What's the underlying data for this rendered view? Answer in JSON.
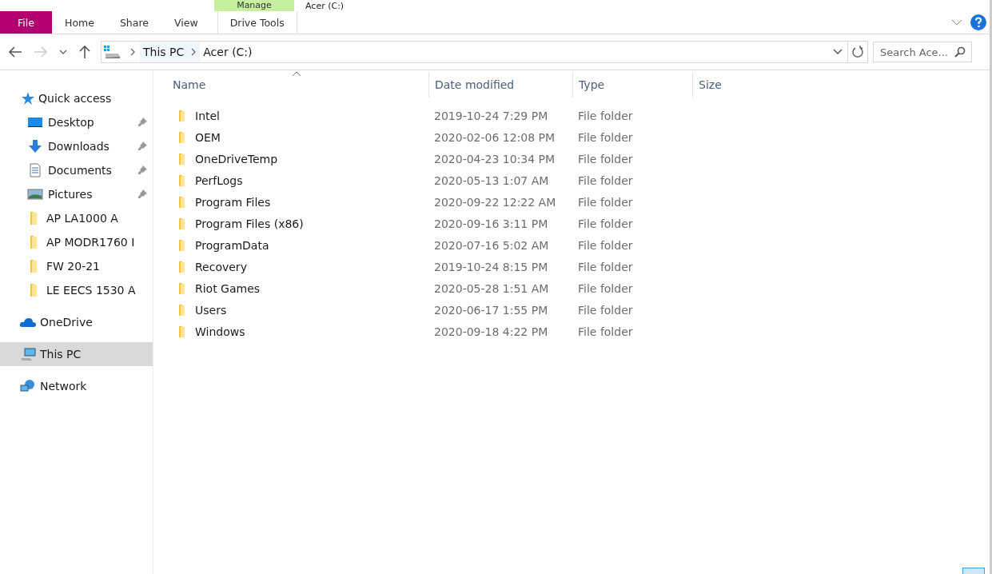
{
  "window": {
    "title": "Acer (C:)"
  },
  "ribbon": {
    "contextual_group": "Manage",
    "tabs": [
      {
        "label": "File",
        "kind": "file"
      },
      {
        "label": "Home",
        "kind": "normal"
      },
      {
        "label": "Share",
        "kind": "normal"
      },
      {
        "label": "View",
        "kind": "normal"
      },
      {
        "label": "Drive Tools",
        "kind": "contextual"
      }
    ]
  },
  "address_bar": {
    "crumbs": [
      "This PC",
      "Acer (C:)"
    ]
  },
  "search": {
    "placeholder": "Search Ace..."
  },
  "sidebar": {
    "items": [
      {
        "label": "Quick access",
        "kind": "quick",
        "pinned": false,
        "selected": false,
        "children": [
          {
            "label": "Desktop",
            "kind": "desktop",
            "pinned": true,
            "selected": false
          },
          {
            "label": "Downloads",
            "kind": "downloads",
            "pinned": true,
            "selected": false
          },
          {
            "label": "Documents",
            "kind": "documents",
            "pinned": true,
            "selected": false
          },
          {
            "label": "Pictures",
            "kind": "pictures",
            "pinned": true,
            "selected": false
          },
          {
            "label": "AP LA1000 A",
            "kind": "folder",
            "pinned": false,
            "selected": false
          },
          {
            "label": "AP MODR1760 I",
            "kind": "folder",
            "pinned": false,
            "selected": false
          },
          {
            "label": "FW 20-21",
            "kind": "folder",
            "pinned": false,
            "selected": false
          },
          {
            "label": "LE EECS 1530 A",
            "kind": "folder",
            "pinned": false,
            "selected": false
          }
        ]
      },
      {
        "label": "OneDrive",
        "kind": "cloud",
        "pinned": false,
        "selected": false
      },
      {
        "label": "This PC",
        "kind": "pc",
        "pinned": false,
        "selected": true
      },
      {
        "label": "Network",
        "kind": "network",
        "pinned": false,
        "selected": false
      }
    ]
  },
  "table": {
    "columns": [
      "Name",
      "Date modified",
      "Type",
      "Size"
    ],
    "rows": [
      {
        "name": "Intel",
        "date": "2019-10-24 7:29 PM",
        "type": "File folder"
      },
      {
        "name": "OEM",
        "date": "2020-02-06 12:08 PM",
        "type": "File folder"
      },
      {
        "name": "OneDriveTemp",
        "date": "2020-04-23 10:34 PM",
        "type": "File folder"
      },
      {
        "name": "PerfLogs",
        "date": "2020-05-13 1:07 AM",
        "type": "File folder"
      },
      {
        "name": "Program Files",
        "date": "2020-09-22 12:22 AM",
        "type": "File folder"
      },
      {
        "name": "Program Files (x86)",
        "date": "2020-09-16 3:11 PM",
        "type": "File folder"
      },
      {
        "name": "ProgramData",
        "date": "2020-07-16 5:02 AM",
        "type": "File folder"
      },
      {
        "name": "Recovery",
        "date": "2019-10-24 8:15 PM",
        "type": "File folder"
      },
      {
        "name": "Riot Games",
        "date": "2020-05-28 1:51 AM",
        "type": "File folder"
      },
      {
        "name": "Users",
        "date": "2020-06-17 1:55 PM",
        "type": "File folder"
      },
      {
        "name": "Windows",
        "date": "2020-09-18 4:22 PM",
        "type": "File folder"
      }
    ]
  }
}
